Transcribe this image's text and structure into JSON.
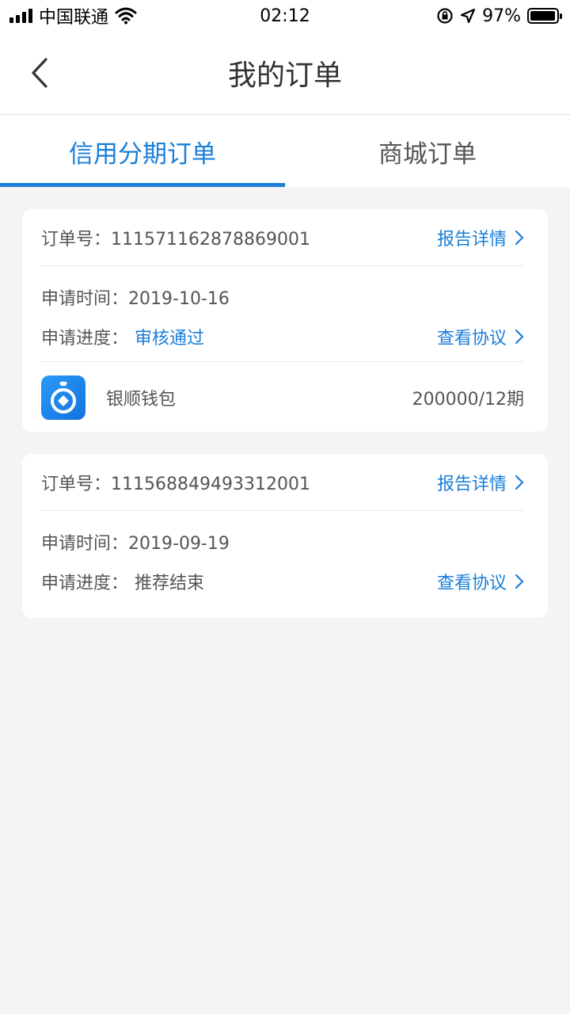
{
  "status_bar": {
    "carrier": "中国联通",
    "time": "02:12",
    "battery": "97%",
    "battery_level": 0.97,
    "icons": [
      "signal-icon",
      "wifi-icon",
      "rotation-lock-icon",
      "location-icon",
      "battery-icon"
    ]
  },
  "header": {
    "title": "我的订单",
    "back_icon": "back-chevron-icon"
  },
  "tabs": [
    {
      "label": "信用分期订单",
      "active": true
    },
    {
      "label": "商城订单",
      "active": false
    }
  ],
  "colors": {
    "accent": "#1a7ed9",
    "background": "#f4f4f4",
    "text": "#555555"
  },
  "orders": [
    {
      "order_label": "订单号：",
      "order_no": "111571162878869001",
      "report_link": "报告详情",
      "apply_time_label": "申请时间：",
      "apply_time": "2019-10-16",
      "progress_label": "申请进度：",
      "progress": "审核通过",
      "progress_color": "#1a7ed9",
      "agreement_link": "查看协议",
      "product": {
        "icon": "wallet-app-icon",
        "name": "银顺钱包",
        "amount": "200000/12期"
      }
    },
    {
      "order_label": "订单号：",
      "order_no": "111568849493312001",
      "report_link": "报告详情",
      "apply_time_label": "申请时间：",
      "apply_time": "2019-09-19",
      "progress_label": "申请进度：",
      "progress": "推荐结束",
      "progress_color": "#555555",
      "agreement_link": "查看协议"
    }
  ]
}
